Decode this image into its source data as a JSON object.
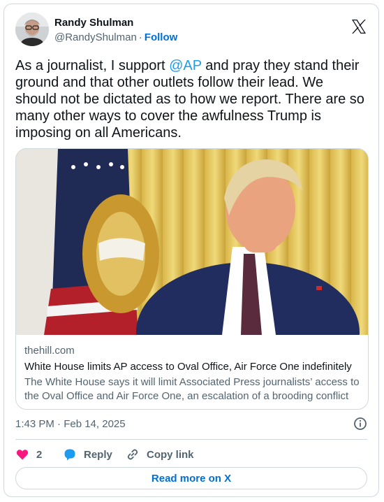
{
  "author": {
    "name": "Randy Shulman",
    "handle": "@RandyShulman",
    "separator": "·",
    "follow_label": "Follow"
  },
  "tweet": {
    "text_before": "As a journalist, I support ",
    "mention": "@AP",
    "text_after": " and pray they stand their ground and that other outlets follow their lead. We should not be dictated as to how we report. There are so many other ways to cover the awfulness Trump is imposing on all Americans."
  },
  "link_card": {
    "domain": "thehill.com",
    "headline": "White House limits AP access to Oval Office, Air Force One indefinitely",
    "description": "The White House says it will limit Associated Press journalists’ access to the Oval Office and Air Force One, an escalation of a brooding conflict …"
  },
  "meta": {
    "timestamp": "1:43 PM · Feb 14, 2025"
  },
  "actions": {
    "like_count": "2",
    "reply_label": "Reply",
    "copy_label": "Copy link"
  },
  "footer": {
    "read_more_label": "Read more on X"
  },
  "colors": {
    "accent": "#1d9bf0",
    "like": "#f91880",
    "text_secondary": "#536471",
    "border": "#cfd9de"
  }
}
